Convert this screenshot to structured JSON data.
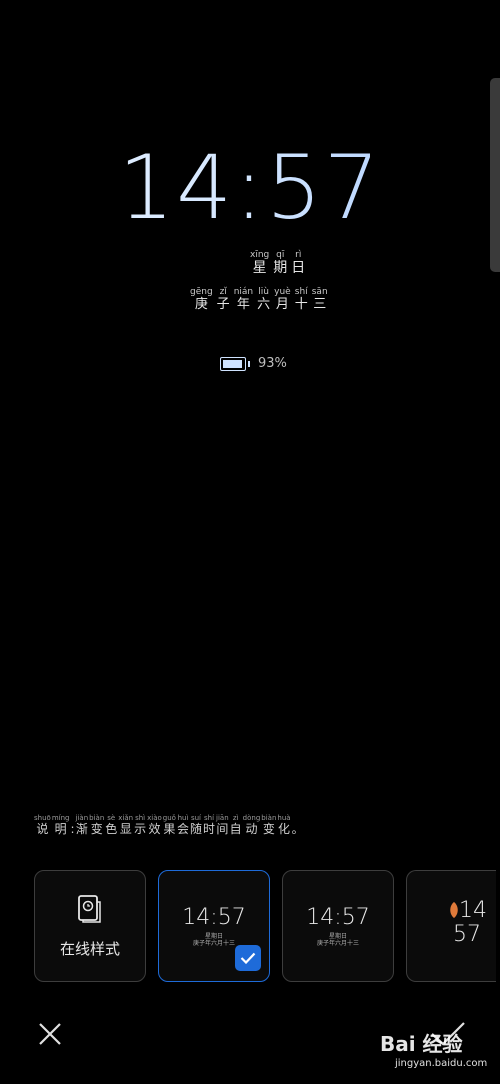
{
  "clock": {
    "time": "14:57"
  },
  "weekday": [
    {
      "pinyin": "xīng",
      "hanzi": "星"
    },
    {
      "pinyin": "qī",
      "hanzi": "期"
    },
    {
      "pinyin": "rì",
      "hanzi": "日"
    }
  ],
  "lunar_date": [
    {
      "pinyin": "gēng",
      "hanzi": "庚"
    },
    {
      "pinyin": "zǐ",
      "hanzi": "子"
    },
    {
      "pinyin": "nián",
      "hanzi": "年"
    },
    {
      "pinyin": "liù",
      "hanzi": "六"
    },
    {
      "pinyin": "yuè",
      "hanzi": "月"
    },
    {
      "pinyin": "shí",
      "hanzi": "十"
    },
    {
      "pinyin": "sān",
      "hanzi": "三"
    }
  ],
  "battery": {
    "percent_text": "93%",
    "level": 0.93
  },
  "note": {
    "label": [
      {
        "pinyin": "shuō",
        "hanzi": "说"
      },
      {
        "pinyin": "míng",
        "hanzi": "明"
      },
      {
        "pinyin": "",
        "hanzi": ":"
      }
    ],
    "text": [
      {
        "pinyin": "jiàn",
        "hanzi": "渐"
      },
      {
        "pinyin": "biàn",
        "hanzi": "变"
      },
      {
        "pinyin": "sè",
        "hanzi": "色"
      },
      {
        "pinyin": "xiǎn",
        "hanzi": "显"
      },
      {
        "pinyin": "shì",
        "hanzi": "示"
      },
      {
        "pinyin": "xiào",
        "hanzi": "效"
      },
      {
        "pinyin": "guǒ",
        "hanzi": "果"
      },
      {
        "pinyin": "huì",
        "hanzi": "会"
      },
      {
        "pinyin": "suí",
        "hanzi": "随"
      },
      {
        "pinyin": "shí",
        "hanzi": "时"
      },
      {
        "pinyin": "jiān",
        "hanzi": "间"
      },
      {
        "pinyin": "zì",
        "hanzi": "自"
      },
      {
        "pinyin": "dòng",
        "hanzi": "动"
      },
      {
        "pinyin": "biàn",
        "hanzi": "变"
      },
      {
        "pinyin": "huà",
        "hanzi": "化"
      },
      {
        "pinyin": "",
        "hanzi": "。"
      }
    ]
  },
  "styles": {
    "online_label": "在线样式",
    "cards": [
      {
        "time": "14:57",
        "selected": true
      },
      {
        "time": "14:57",
        "selected": false
      }
    ],
    "partial_time_line1": "14",
    "partial_time_line2": "57"
  },
  "watermark": {
    "text": "Bai 经验",
    "url": "jingyan.baidu.com"
  },
  "colors": {
    "accent": "#1e6bd9",
    "clock_gradient_end": "#a9cbff"
  }
}
